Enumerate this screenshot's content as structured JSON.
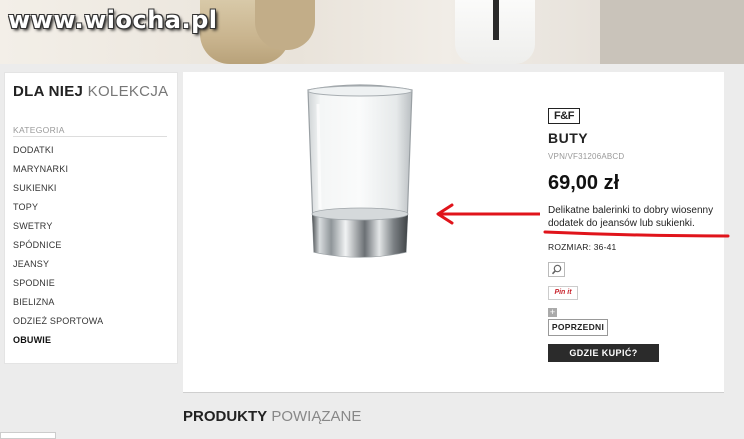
{
  "watermark": "www.wiocha.pl",
  "sidebar": {
    "title_bold": "DLA NIEJ",
    "title_light": "KOLEKCJA",
    "category_label": "KATEGORIA",
    "items": [
      {
        "label": "DODATKI"
      },
      {
        "label": "MARYNARKI"
      },
      {
        "label": "SUKIENKI"
      },
      {
        "label": "TOPY"
      },
      {
        "label": "SWETRY"
      },
      {
        "label": "SPÓDNICE"
      },
      {
        "label": "JEANSY"
      },
      {
        "label": "SPODNIE"
      },
      {
        "label": "BIELIZNA"
      },
      {
        "label": "ODZIEŻ SPORTOWA"
      },
      {
        "label": "OBUWIE"
      }
    ],
    "active_item": "OBUWIE"
  },
  "product": {
    "brand_logo": "F&F",
    "name": "BUTY",
    "sku": "VPN/VF31206ABCD",
    "price": "69,00 zł",
    "description": "Delikatne balerinki to dobry wiosenny dodatek do jeansów lub sukienki.",
    "size": "ROZMIAR: 36-41",
    "pinit_label": "Pin it",
    "prev_label": "POPRZEDNI",
    "buy_label": "GDZIE KUPIĆ?"
  },
  "related": {
    "title_bold": "PRODUKTY",
    "title_light": "POWIĄZANE"
  },
  "colors": {
    "annotation_red": "#e0141b",
    "button_dark": "#2b2b2b"
  },
  "icons": {
    "zoom": "magnifier-icon",
    "add": "plus-icon"
  }
}
